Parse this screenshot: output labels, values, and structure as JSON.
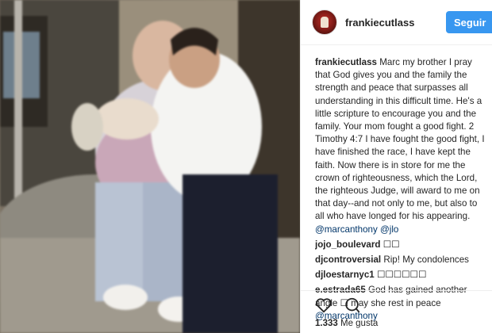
{
  "post": {
    "username": "frankiecutlass",
    "follow_label": "Seguir",
    "caption_user": "frankiecutlass",
    "caption_text": "Marc my brother I pray that God gives you and the family the strength and peace that surpasses all understanding in this difficult time. He's a little scripture to encourage you and the family. Your mom fought a good fight. 2 Timothy 4:7 I have fought the good fight, I have finished the race, I have kept the faith. Now there is in store for me the crown of righteousness, which the Lord, the righteous Judge, will award to me on that day--and not only to me, but also to all who have longed for his appearing.",
    "caption_mentions": "@marcanthony @jlo"
  },
  "comments": [
    {
      "user": "jojo_boulevard",
      "text": "☐☐"
    },
    {
      "user": "djcontroversial",
      "text": "Rip! My condolences"
    },
    {
      "user": "djloestarnyc1",
      "text": "☐☐☐☐☐☐"
    },
    {
      "user": "e.estrada65",
      "text": "God has gained another angle ☐ may she rest in peace",
      "mention": "@marcanthony"
    }
  ],
  "likes": {
    "count": "1.333",
    "label": "Me gusta"
  },
  "icons": {
    "like": "heart-icon",
    "comment": "comment-icon"
  },
  "colors": {
    "follow_button": "#3897f0",
    "mention_link": "#003569"
  }
}
